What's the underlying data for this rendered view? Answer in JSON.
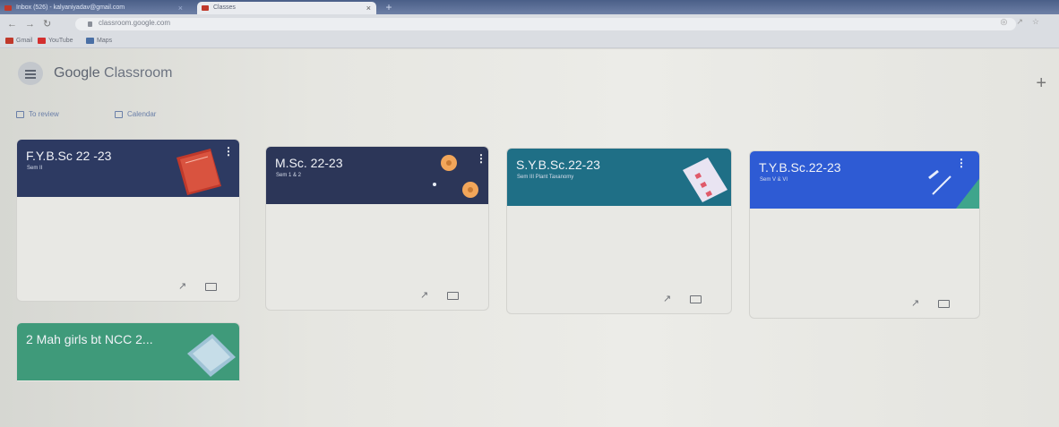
{
  "browser": {
    "tabs": [
      {
        "label": "Inbox (526) - kalyaniyadav@gmail.com",
        "active": false
      },
      {
        "label": "Classes",
        "active": true
      }
    ],
    "new_tab": "+",
    "url": "classroom.google.com",
    "bookmarks": [
      "Gmail",
      "YouTube",
      "Maps"
    ]
  },
  "header": {
    "brand_google": "Google",
    "brand_app": "Classroom",
    "add_button": "+"
  },
  "subnav": {
    "to_review": "To review",
    "calendar": "Calendar"
  },
  "classes": [
    {
      "title": "F.Y.B.Sc 22 -23",
      "section": "Sem II",
      "color": "#2d3a62"
    },
    {
      "title": "M.Sc. 22-23",
      "section": "Sem 1 & 2",
      "color": "#2c3658"
    },
    {
      "title": "S.Y.B.Sc.22-23",
      "section": "Sem III Plant Taxanomy",
      "color": "#1f6f86"
    },
    {
      "title": "T.Y.B.Sc.22-23",
      "section": "Sem V & VI",
      "color": "#2e5bd4"
    },
    {
      "title": "2 Mah girls bt NCC 2...",
      "section": "",
      "color": "#3f9a7a"
    }
  ],
  "icons": {
    "more": "⋮",
    "trend": "↗"
  }
}
